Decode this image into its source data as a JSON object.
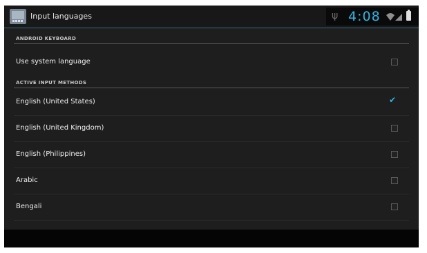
{
  "window": {
    "title": "Input languages",
    "app_icon": "keyboard-settings-icon"
  },
  "status_bar": {
    "time": "4:08",
    "icons": [
      "usb-icon",
      "wifi-icon",
      "signal-icon",
      "battery-icon"
    ],
    "accent_color": "#33b5e5"
  },
  "sections": [
    {
      "header": "ANDROID KEYBOARD",
      "items": [
        {
          "label": "Use system language",
          "checked": false
        }
      ]
    },
    {
      "header": "ACTIVE INPUT METHODS",
      "items": [
        {
          "label": "English (United States)",
          "checked": true
        },
        {
          "label": "English (United Kingdom)",
          "checked": false
        },
        {
          "label": "English (Philippines)",
          "checked": false
        },
        {
          "label": "Arabic",
          "checked": false
        },
        {
          "label": "Bengali",
          "checked": false
        }
      ]
    }
  ]
}
